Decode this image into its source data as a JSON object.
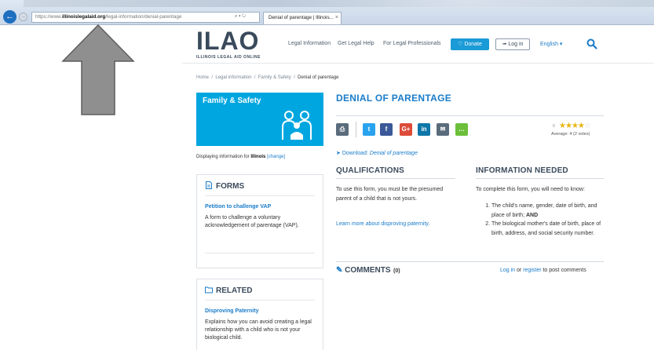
{
  "browser": {
    "url_prefix": "https://www.",
    "url_domain": "illinoislegalaid.org",
    "url_path": "/legal-information/denial-parentage",
    "addr_tools": "⌕ ▾ ↻",
    "tab_title": "Denial of parentage | Illinois...",
    "tab_close": "×"
  },
  "header": {
    "logo_text": "ILAO",
    "logo_sub": "ILLINOIS LEGAL AID ONLINE",
    "nav": [
      "Legal Information",
      "Get Legal Help",
      "For Legal Professionals"
    ],
    "donate_label": "♡ Donate",
    "login_label": "➟ Log in",
    "language_label": "English ▾"
  },
  "breadcrumb": {
    "items": [
      "Home",
      "Legal information",
      "Family & Safety"
    ],
    "separator": "/",
    "current": "Denial of parentage"
  },
  "sidebar": {
    "category_title": "Family & Safety",
    "display_prefix": "Displaying information for ",
    "display_state": "Illinois",
    "display_change": "[change]",
    "forms": {
      "heading": "FORMS",
      "link": "Petition to challenge VAP",
      "description": "A form to challenge a voluntary acknowledgement of parentage (VAP)."
    },
    "related": {
      "heading": "RELATED",
      "link": "Disproving Paternity",
      "description": "Explains how you can avoid creating a legal relationship with a child who is not your biological child."
    }
  },
  "main": {
    "title": "DENIAL OF PARENTAGE",
    "rating": {
      "num_ratings": "0",
      "stars_filled": 4,
      "stars_total": 5,
      "average_text": "Average: 4 (2 votes)"
    },
    "share_icons": [
      {
        "name": "print-icon",
        "glyph": "⎙",
        "color": "#5a6b7c"
      },
      {
        "name": "twitter-icon",
        "glyph": "t",
        "color": "#2aa3ef"
      },
      {
        "name": "facebook-icon",
        "glyph": "f",
        "color": "#3b5998"
      },
      {
        "name": "googleplus-icon",
        "glyph": "G+",
        "color": "#dd4b39"
      },
      {
        "name": "linkedin-icon",
        "glyph": "in",
        "color": "#0e76a8"
      },
      {
        "name": "email-icon",
        "glyph": "✉",
        "color": "#5a6b7c"
      },
      {
        "name": "sms-icon",
        "glyph": "…",
        "color": "#6cbf3a"
      }
    ],
    "download_label": "Download: ",
    "download_link": "Denial of parentage",
    "qualifications": {
      "heading": "QUALIFICATIONS",
      "text": "To use this form, you must be the presumed parent of a child that is not yours.",
      "link": "Learn more about disproving paternity."
    },
    "info_needed": {
      "heading": "INFORMATION NEEDED",
      "intro": "To complete this form, you will need to know:",
      "items": [
        "The child's name, gender, date of birth, and place of birth; AND",
        "The biological mother's date of birth, place of birth, address, and social security number."
      ]
    },
    "comments": {
      "heading": "COMMENTS",
      "count": "(0)",
      "login_link": "Log in",
      "or": " or ",
      "register_link": "register",
      "suffix": " to post comments"
    }
  },
  "colors": {
    "accent": "#1a7cc9",
    "banner": "#00a6e0",
    "donate": "#1a9ad6",
    "star": "#e8b50e"
  }
}
